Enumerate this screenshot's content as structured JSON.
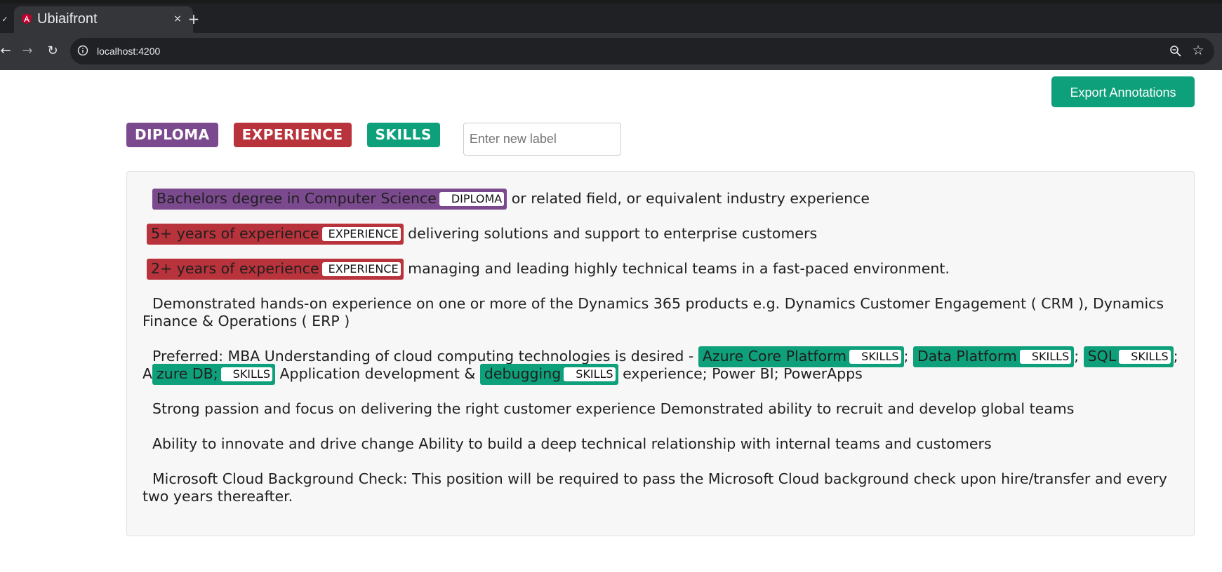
{
  "browser": {
    "tab_title": "Ubiaifront",
    "tab_close": "×",
    "new_tab": "+",
    "url": "localhost:4200",
    "back": "←",
    "forward": "→",
    "reload": "↻",
    "star": "☆"
  },
  "toolbar": {
    "export_label": "Export Annotations"
  },
  "labels": [
    {
      "text": "DIPLOMA",
      "color": "#7b4a8e"
    },
    {
      "text": "EXPERIENCE",
      "color": "#b8333b"
    },
    {
      "text": "SKILLS",
      "color": "#0ea07a"
    }
  ],
  "new_label": {
    "placeholder": "Enter new label",
    "value": ""
  },
  "colors": {
    "DIPLOMA": "#7b4a8e",
    "EXPERIENCE": "#b8333b",
    "SKILLS": "#0ea07a"
  },
  "lines": [
    [
      {
        "ann": true,
        "text": "Bachelors degree in Computer Science",
        "label": "DIPLOMA"
      },
      {
        "text": " or related field, or equivalent industry experience"
      }
    ],
    [
      {
        "ann": true,
        "text": "5+ years of experience",
        "label": "EXPERIENCE"
      },
      {
        "text": " delivering solutions and support to enterprise customers"
      }
    ],
    [
      {
        "ann": true,
        "text": "2+ years of experience",
        "label": "EXPERIENCE"
      },
      {
        "text": " managing and leading highly technical teams in a fast-paced environment."
      }
    ],
    [
      {
        "text": "Demonstrated hands-on experience on one or more of the Dynamics 365 products e.g. Dynamics Customer Engagement ( CRM ), Dynamics Finance & Operations ( ERP )"
      }
    ],
    [
      {
        "text": "Preferred: MBA Understanding of cloud computing technologies is desired - "
      },
      {
        "ann": true,
        "text": "Azure Core Platform",
        "label": "SKILLS"
      },
      {
        "text": "; "
      },
      {
        "ann": true,
        "text": "Data Platform",
        "label": "SKILLS"
      },
      {
        "text": "; "
      },
      {
        "ann": true,
        "text": "SQL",
        "label": "SKILLS"
      },
      {
        "text": "; A"
      },
      {
        "ann": true,
        "text": "zure DB;",
        "label": "SKILLS"
      },
      {
        "text": " Application development & "
      },
      {
        "ann": true,
        "text": "debugging",
        "label": "SKILLS"
      },
      {
        "text": " experience; Power BI; PowerApps"
      }
    ],
    [
      {
        "text": "Strong passion and focus on delivering the right customer experience Demonstrated ability to recruit and develop global teams"
      }
    ],
    [
      {
        "text": "Ability to innovate and drive change Ability to build a deep technical relationship with internal teams and customers"
      }
    ],
    [
      {
        "text": "Microsoft Cloud Background Check: This position will be required to pass the Microsoft Cloud background check upon hire/transfer and every two years thereafter."
      }
    ]
  ]
}
